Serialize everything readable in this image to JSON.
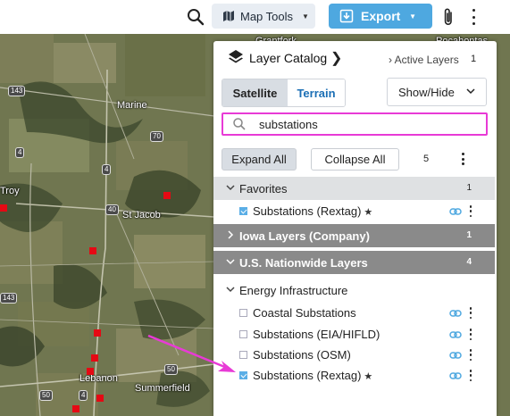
{
  "toolbar": {
    "map_tools_label": "Map Tools",
    "export_label": "Export"
  },
  "map": {
    "towns": [
      "Grantfork",
      "Pocahontas",
      "Marine",
      "Troy",
      "St Jacob",
      "Lebanon",
      "Summerfield"
    ],
    "highway_shields": [
      "143",
      "70",
      "4",
      "4",
      "40",
      "143",
      "50",
      "50",
      "4"
    ]
  },
  "catalog": {
    "title": "Layer Catalog",
    "active_layers_label": "Active Layers",
    "active_layers_count": "1",
    "basemap_options": [
      "Satellite",
      "Terrain"
    ],
    "basemap_selected": "Satellite",
    "show_hide_label": "Show/Hide",
    "search_value": "substations",
    "expand_all_label": "Expand All",
    "collapse_all_label": "Collapse All",
    "result_count": "5",
    "groups": {
      "favorites": {
        "label": "Favorites",
        "count": "1"
      },
      "iowa": {
        "label": "Iowa Layers (Company)",
        "count": "1"
      },
      "us": {
        "label": "U.S. Nationwide Layers",
        "count": "4"
      },
      "energy": {
        "label": "Energy Infrastructure"
      }
    },
    "favorite_layers": [
      {
        "label": "Substations (Rextag)",
        "checked": true,
        "starred": true
      }
    ],
    "energy_layers": [
      {
        "label": "Coastal Substations",
        "checked": false,
        "starred": false
      },
      {
        "label": "Substations (EIA/HIFLD)",
        "checked": false,
        "starred": false
      },
      {
        "label": "Substations (OSM)",
        "checked": false,
        "starred": false
      },
      {
        "label": "Substations (Rextag)",
        "checked": true,
        "starred": true
      }
    ],
    "star_glyph": "★"
  },
  "colors": {
    "export_button": "#4ea8e0",
    "search_highlight": "#e83ad6",
    "annotation_arrow": "#e83ad6",
    "substation_marker": "#e50914"
  }
}
